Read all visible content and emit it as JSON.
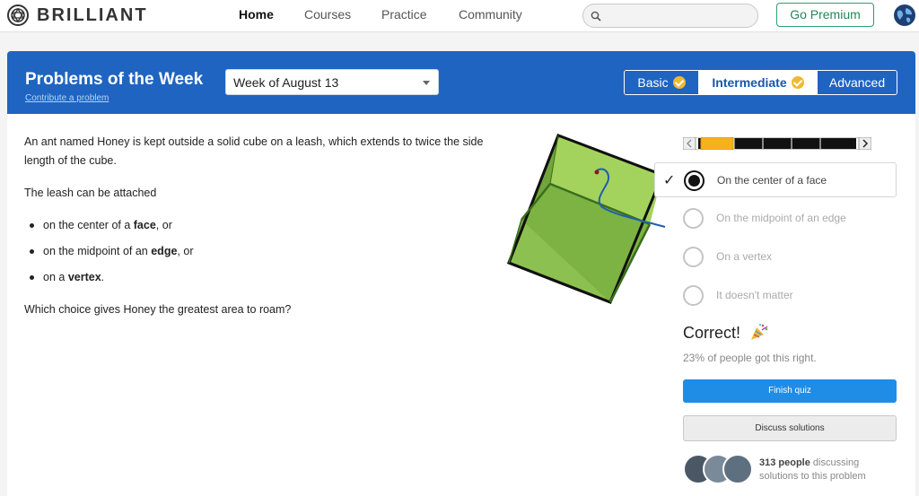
{
  "nav": {
    "brand": "BRILLIANT",
    "links": [
      "Home",
      "Courses",
      "Practice",
      "Community"
    ],
    "active": "Home",
    "search_placeholder": "",
    "premium_label": "Go Premium"
  },
  "header": {
    "title": "Problems of the Week",
    "contribute_link": "Contribute a problem",
    "week_selected": "Week of August 13",
    "tabs": [
      {
        "label": "Basic",
        "completed": true,
        "active": false
      },
      {
        "label": "Intermediate",
        "completed": true,
        "active": true
      },
      {
        "label": "Advanced",
        "completed": false,
        "active": false
      }
    ]
  },
  "problem": {
    "intro": "An ant named Honey is kept outside a solid cube on a leash, which extends to twice the side length of the cube.",
    "lead": "The leash can be attached",
    "bullets": [
      {
        "pre": "on the center of a ",
        "bold": "face",
        "post": ", or"
      },
      {
        "pre": "on the midpoint of an ",
        "bold": "edge",
        "post": ", or"
      },
      {
        "pre": "on a ",
        "bold": "vertex",
        "post": "."
      }
    ],
    "question": "Which choice gives Honey the greatest area to roam?"
  },
  "progress": {
    "current_problem_fraction": 0.0
  },
  "answers": {
    "options": [
      {
        "label": "On the center of a face",
        "selected": true
      },
      {
        "label": "On the midpoint of an edge",
        "selected": false
      },
      {
        "label": "On a vertex",
        "selected": false
      },
      {
        "label": "It doesn't matter",
        "selected": false
      }
    ],
    "result_label": "Correct!",
    "result_icon": "party-popper-icon",
    "stat": "23% of people got this right.",
    "finish_label": "Finish quiz",
    "discuss_label": "Discuss solutions",
    "discussion_count": "313 people",
    "discussion_suffix": "discussing",
    "discussion_line2": "solutions to this problem"
  },
  "colors": {
    "brand_blue": "#1f64c0",
    "premium_green": "#2aa06f",
    "check_gold": "#f1b830",
    "finish_blue": "#1f8de6",
    "cube_green": "#8cc152"
  }
}
